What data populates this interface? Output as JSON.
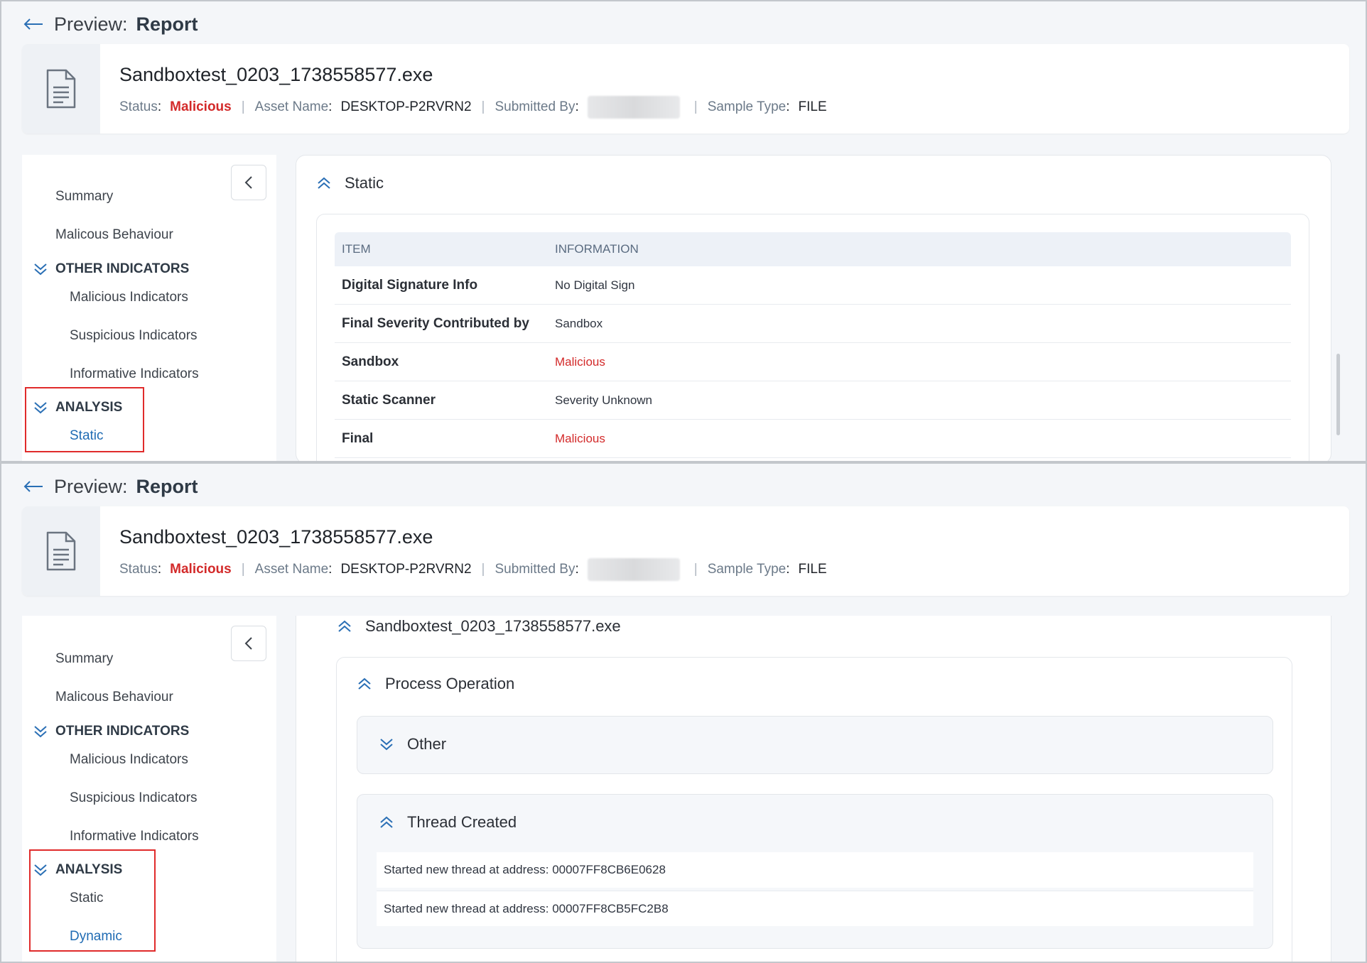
{
  "header": {
    "title_prefix": "Preview:",
    "title_main": "Report",
    "file_name": "Sandboxtest_0203_1738558577.exe",
    "status_label": "Status",
    "status_value": "Malicious",
    "asset_label": "Asset Name",
    "asset_value": "DESKTOP-P2RVRN2",
    "submitted_label": "Submitted By",
    "sample_type_label": "Sample Type",
    "sample_type_value": "FILE",
    "separator": "|",
    "colon": ":"
  },
  "sidebar": {
    "summary": "Summary",
    "malicious_behaviour": "Malicous Behaviour",
    "other_indicators": "OTHER INDICATORS",
    "malicious_indicators": "Malicious Indicators",
    "suspicious_indicators": "Suspicious Indicators",
    "informative_indicators": "Informative Indicators",
    "analysis": "ANALYSIS",
    "static": "Static",
    "dynamic": "Dynamic"
  },
  "static_section": {
    "title": "Static",
    "columns": [
      "ITEM",
      "INFORMATION"
    ],
    "rows": [
      {
        "item": "Digital Signature Info",
        "info": "No Digital Sign"
      },
      {
        "item": "Final Severity Contributed by",
        "info": "Sandbox"
      },
      {
        "item": "Sandbox",
        "info": "Malicious"
      },
      {
        "item": "Static Scanner",
        "info": "Severity Unknown"
      },
      {
        "item": "Final",
        "info": "Malicious"
      }
    ]
  },
  "dynamic_section": {
    "file_title": "Sandboxtest_0203_1738558577.exe",
    "process_operation": "Process Operation",
    "other": "Other",
    "thread_created": "Thread Created",
    "threads": [
      "Started new thread at address: 00007FF8CB6E0628",
      "Started new thread at address: 00007FF8CB5FC2B8"
    ]
  },
  "colors": {
    "accent_blue": "#1f6bb3",
    "malicious_red": "#d32a2a",
    "highlight_red": "#e02b2b"
  }
}
